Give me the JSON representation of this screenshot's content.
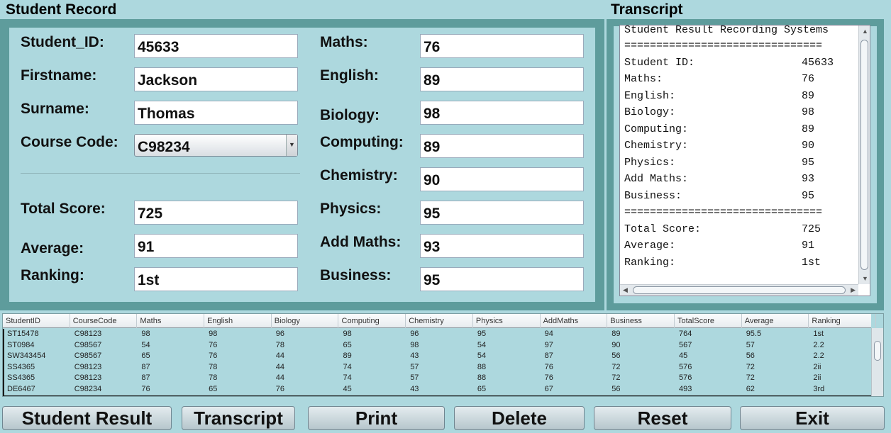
{
  "student_record": {
    "title": "Student Record",
    "fields": {
      "student_id": {
        "label": "Student_ID:",
        "value": "45633"
      },
      "firstname": {
        "label": "Firstname:",
        "value": "Jackson"
      },
      "surname": {
        "label": "Surname:",
        "value": "Thomas"
      },
      "course_code": {
        "label": "Course Code:",
        "value": "C98234"
      },
      "total_score": {
        "label": "Total Score:",
        "value": "725"
      },
      "average": {
        "label": "Average:",
        "value": "91"
      },
      "ranking": {
        "label": "Ranking:",
        "value": "1st"
      }
    },
    "subjects": {
      "maths": {
        "label": "Maths:",
        "value": "76"
      },
      "english": {
        "label": "English:",
        "value": "89"
      },
      "biology": {
        "label": "Biology:",
        "value": "98"
      },
      "computing": {
        "label": "Computing:",
        "value": "89"
      },
      "chemistry": {
        "label": "Chemistry:",
        "value": "90"
      },
      "physics": {
        "label": "Physics:",
        "value": "95"
      },
      "add_maths": {
        "label": "Add Maths:",
        "value": "93"
      },
      "business": {
        "label": "Business:",
        "value": "95"
      }
    }
  },
  "transcript": {
    "title": "Transcript",
    "header": "Student Result Recording Systems",
    "separator": "===============================",
    "lines": [
      {
        "label": "Student ID:",
        "value": "45633"
      },
      {
        "label": "Maths:",
        "value": "76"
      },
      {
        "label": "English:",
        "value": "89"
      },
      {
        "label": "Biology:",
        "value": "98"
      },
      {
        "label": "Computing:",
        "value": "89"
      },
      {
        "label": "Chemistry:",
        "value": "90"
      },
      {
        "label": "Physics:",
        "value": "95"
      },
      {
        "label": "Add Maths:",
        "value": "93"
      },
      {
        "label": "Business:",
        "value": "95"
      }
    ],
    "summary": [
      {
        "label": "Total Score:",
        "value": "725"
      },
      {
        "label": "Average:",
        "value": "91"
      },
      {
        "label": "Ranking:",
        "value": "1st"
      }
    ]
  },
  "table": {
    "columns": [
      "StudentID",
      "CourseCode",
      "Maths",
      "English",
      "Biology",
      "Computing",
      "Chemistry",
      "Physics",
      "AddMaths",
      "Business",
      "TotalScore",
      "Average",
      "Ranking"
    ],
    "rows": [
      [
        "ST15478",
        "C98123",
        "98",
        "98",
        "96",
        "98",
        "96",
        "95",
        "94",
        "89",
        "764",
        "95.5",
        "1st"
      ],
      [
        "ST0984",
        "C98567",
        "54",
        "76",
        "78",
        "65",
        "98",
        "54",
        "97",
        "90",
        "567",
        "57",
        "2.2"
      ],
      [
        "SW343454",
        "C98567",
        "65",
        "76",
        "44",
        "89",
        "43",
        "54",
        "87",
        "56",
        "45",
        "56",
        "2.2"
      ],
      [
        "SS4365",
        "C98123",
        "87",
        "78",
        "44",
        "74",
        "57",
        "88",
        "76",
        "72",
        "576",
        "72",
        "2ii"
      ],
      [
        "SS4365",
        "C98123",
        "87",
        "78",
        "44",
        "74",
        "57",
        "88",
        "76",
        "72",
        "576",
        "72",
        "2ii"
      ],
      [
        "DE6467",
        "C98234",
        "76",
        "65",
        "76",
        "45",
        "43",
        "65",
        "67",
        "56",
        "493",
        "62",
        "3rd"
      ]
    ]
  },
  "buttons": {
    "student_result": "Student Result",
    "transcript": "Transcript",
    "print": "Print",
    "delete": "Delete",
    "reset": "Reset",
    "exit": "Exit"
  }
}
